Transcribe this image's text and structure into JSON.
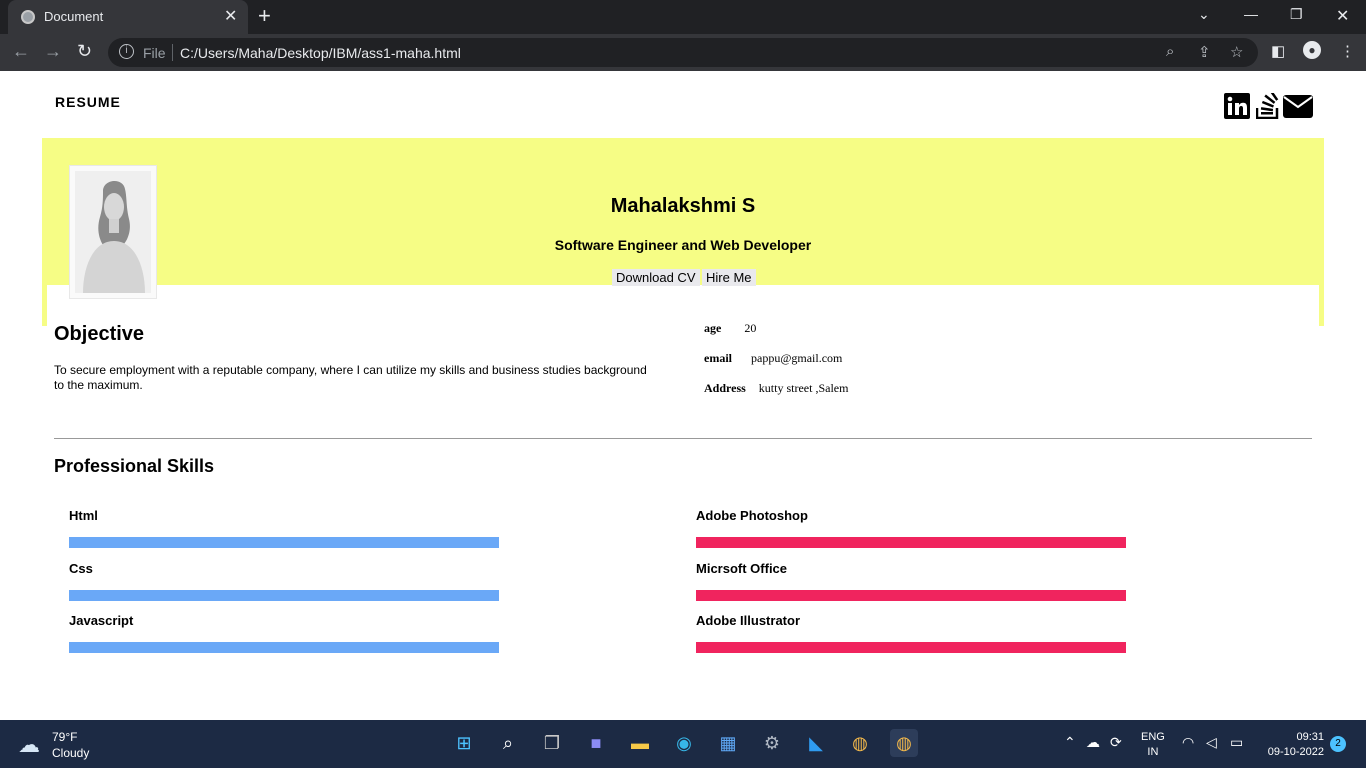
{
  "browser": {
    "tab_title": "Document",
    "tab_close": "✕",
    "new_tab": "+",
    "url_scheme": "File",
    "url": "C:/Users/Maha/Desktop/IBM/ass1-maha.html"
  },
  "page": {
    "brand": "RESUME",
    "hero": {
      "name": "Mahalakshmi S",
      "role": "Software Engineer and Web Developer",
      "download_cv": "Download CV",
      "hire_me": "Hire Me",
      "background_color": "#f6fd85"
    },
    "objective": {
      "title": "Objective",
      "text": "To secure employment with a reputable company, where I can utilize my skills and business studies background to the maximum."
    },
    "info": [
      {
        "key": "age",
        "value": "20"
      },
      {
        "key": "email",
        "value": "pappu@gmail.com"
      },
      {
        "key": "Address",
        "value": "kutty street ,Salem"
      }
    ],
    "skills": {
      "title": "Professional Skills",
      "left_color": "#6aa8f7",
      "right_color": "#f0245e",
      "left": [
        {
          "label": "Html",
          "level": 1.0
        },
        {
          "label": "Css",
          "level": 1.0
        },
        {
          "label": "Javascript",
          "level": 1.0
        }
      ],
      "right": [
        {
          "label": "Adobe Photoshop",
          "level": 1.0
        },
        {
          "label": "Micrsoft Office",
          "level": 1.0
        },
        {
          "label": "Adobe Illustrator",
          "level": 1.0
        }
      ]
    },
    "social_icons": [
      "linkedin-icon",
      "stackoverflow-icon",
      "email-icon"
    ]
  },
  "taskbar": {
    "temperature": "79°F",
    "condition": "Cloudy",
    "lang_top": "ENG",
    "lang_bottom": "IN",
    "time": "09:31",
    "date": "09-10-2022",
    "notifications": "2"
  }
}
